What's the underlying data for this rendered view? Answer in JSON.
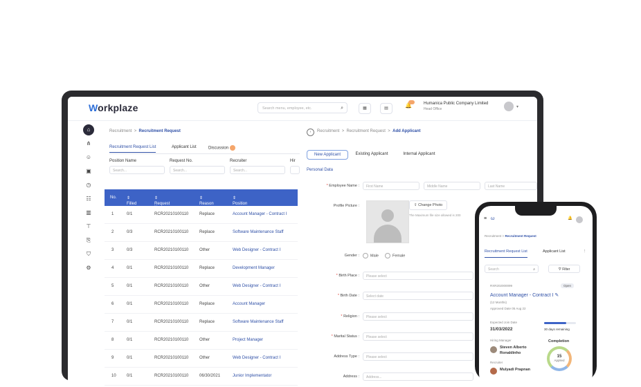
{
  "app": {
    "logo_rest": "orkplaze",
    "logo_w": "W",
    "search_placeholder": "Search menu, employee, etc.",
    "company_name": "Humanica Public Company Limited",
    "company_sub": "Head Office"
  },
  "left": {
    "breadcrumb_root": "Recruitment",
    "breadcrumb_sep": ">",
    "breadcrumb_current": "Recruitment Request",
    "tabs": [
      "Recruitment Request List",
      "Applicant List",
      "Discussion"
    ],
    "filters": [
      {
        "label": "Position Name",
        "placeholder": "Search..."
      },
      {
        "label": "Request No.",
        "placeholder": "Search..."
      },
      {
        "label": "Recruiter",
        "placeholder": "Search..."
      },
      {
        "label": "Hir",
        "placeholder": ""
      }
    ],
    "table_headers": [
      "No.",
      "Filled",
      "Request No",
      "Reason",
      "Position"
    ],
    "rows": [
      {
        "no": "1",
        "filled": "0/1",
        "req": "RCR20210100110",
        "reason": "Replace",
        "position": "Account Manager - Contract I"
      },
      {
        "no": "2",
        "filled": "0/3",
        "req": "RCR20210100110",
        "reason": "Replace",
        "position": "Software Maintenance Staff"
      },
      {
        "no": "3",
        "filled": "0/3",
        "req": "RCR20210100110",
        "reason": "Other",
        "position": "Web Designer - Contract I"
      },
      {
        "no": "4",
        "filled": "0/1",
        "req": "RCR20210100110",
        "reason": "Replace",
        "position": "Development Manager"
      },
      {
        "no": "5",
        "filled": "0/1",
        "req": "RCR20210100110",
        "reason": "Other",
        "position": "Web Designer - Contract I"
      },
      {
        "no": "6",
        "filled": "0/1",
        "req": "RCR20210100110",
        "reason": "Replace",
        "position": "Account Manager"
      },
      {
        "no": "7",
        "filled": "0/1",
        "req": "RCR20210100110",
        "reason": "Replace",
        "position": "Software Maintenance Staff"
      },
      {
        "no": "8",
        "filled": "0/1",
        "req": "RCR20210100110",
        "reason": "Other",
        "position": "Project Manager"
      },
      {
        "no": "9",
        "filled": "0/1",
        "req": "RCR20210100110",
        "reason": "Other",
        "position": "Web Designer - Contract I"
      },
      {
        "no": "10",
        "filled": "0/1",
        "req": "RCR20210100110",
        "reason": "06/30/2021",
        "position": "Junior Implementator"
      }
    ]
  },
  "right": {
    "crumb1": "Recruitment",
    "crumb2": "Recruitment Request",
    "crumb_current": "Add Applicant",
    "sep": ">",
    "segments": [
      "New Applicant",
      "Existing Applicant",
      "Internal Applicant"
    ],
    "section": "Personal Data",
    "employee_name_label": "Employee Name :",
    "first_name": "First Name",
    "middle_name": "Middle Name",
    "last_name": "Last Name",
    "profile_label": "Profile Picture :",
    "change_photo": "Change Photo",
    "photo_note": "The Maximum file size allowed is 200",
    "gender_label": "Gender :",
    "male": "Male",
    "female": "Female",
    "birth_place_label": "Birth Place :",
    "birth_place_ph": "Please select",
    "birth_date_label": "Birth Date :",
    "birth_date_ph": "Select date",
    "religion_label": "Religion :",
    "religion_ph": "Please select",
    "marital_label": "Marital Status :",
    "marital_ph": "Please select",
    "address_type_label": "Address Type :",
    "address_type_ph": "Please select",
    "address_label": "Address :",
    "address_ph": "Address..."
  },
  "phone": {
    "crumb_root": "Recruitment",
    "crumb_sep": ">",
    "crumb_current": "Recruitment Request",
    "tabs": [
      "Recruitment Request List",
      "Applicant List"
    ],
    "search_ph": "Search",
    "filter": "Filter",
    "req_no": "RXR202000099",
    "status": "Open",
    "position": "Account Manager - Contract I",
    "duration": "(12 Months)",
    "approved": "Approved Date 05 Aug 22",
    "expected_label": "Expected Join Date",
    "expected_date": "31/03/2022",
    "days_remaining": "30 days remaining",
    "days_progress": 0.7,
    "hiring_label": "Hiring Manager",
    "hiring_name_1": "Steven Alberto",
    "hiring_name_2": "Ronaldinho",
    "recruiter_label": "Recruiter",
    "recruiter_name": "Mulyadi Prapnan",
    "completion_label": "Completion",
    "completion_value": "15",
    "completion_sub": "Applied"
  },
  "colors": {
    "primary": "#3d63c6",
    "link": "#2e4fa6",
    "badge": "#f5a66b"
  }
}
